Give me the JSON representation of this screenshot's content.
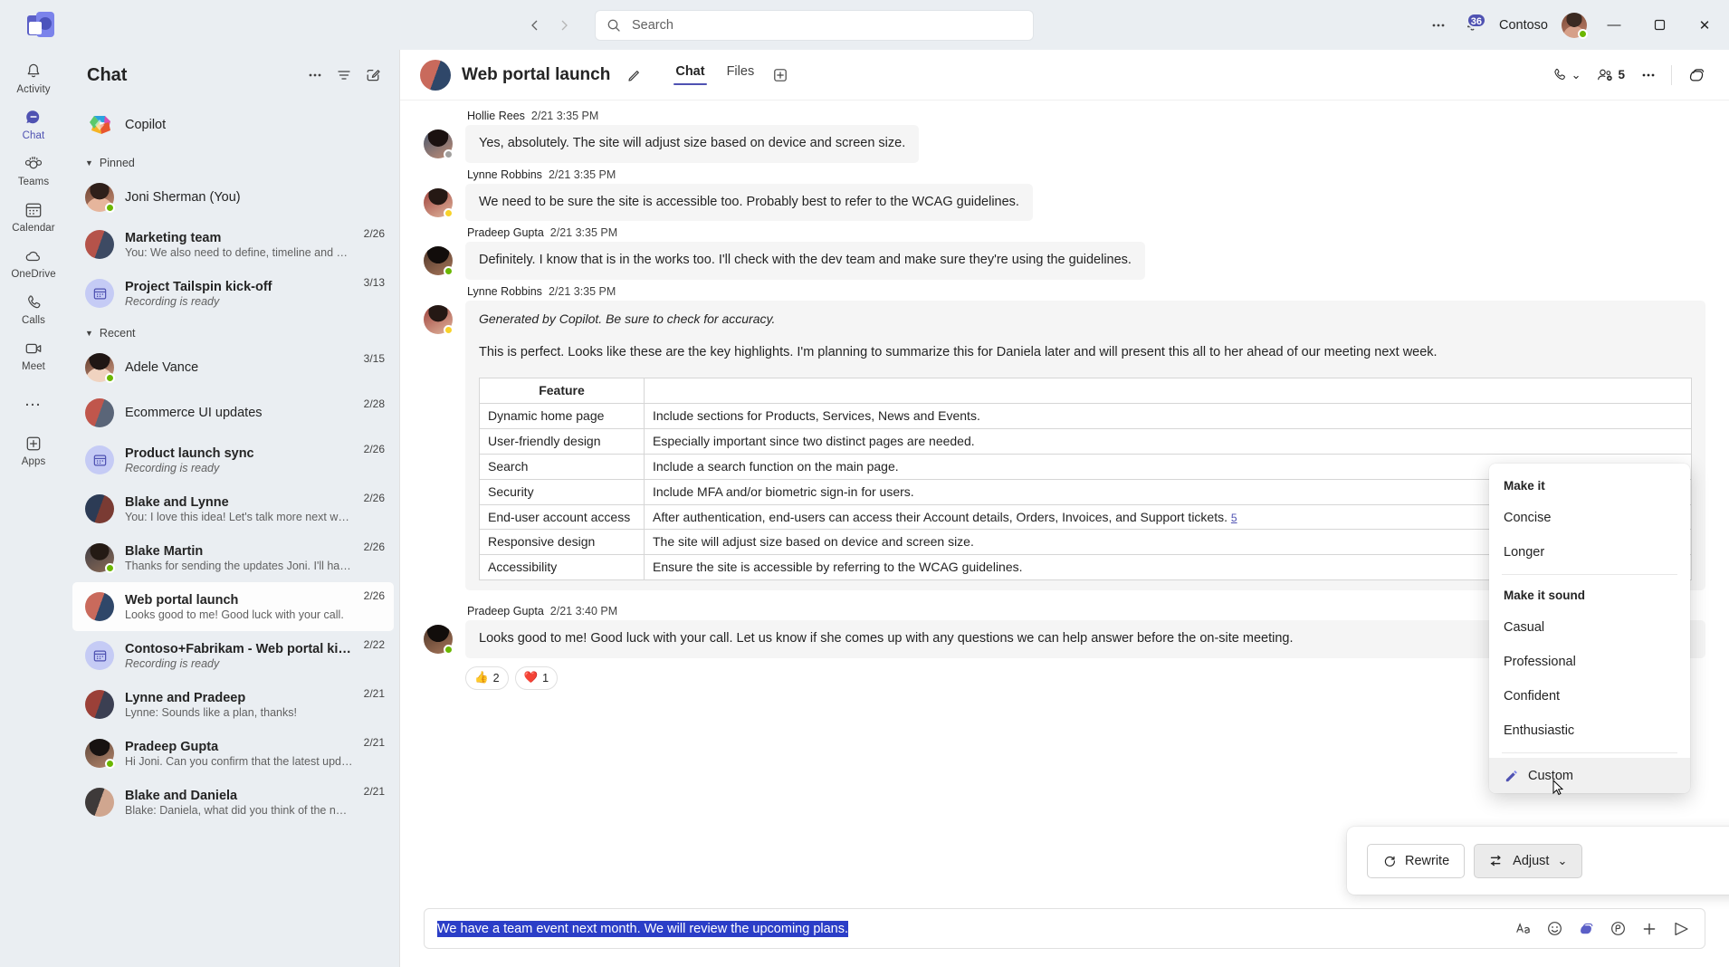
{
  "titlebar": {
    "app_logo": "teams-logo",
    "back_label": "‹",
    "forward_label": "›",
    "search": {
      "placeholder": "Search",
      "value": ""
    },
    "more_label": "…",
    "notification_badge": "36",
    "tenant": "Contoso",
    "minimize": "—",
    "maximize": "❐",
    "close": "✕"
  },
  "rail": {
    "items": [
      {
        "label": "Activity",
        "icon": "bell-icon"
      },
      {
        "label": "Chat",
        "icon": "chat-icon"
      },
      {
        "label": "Teams",
        "icon": "teams-people-icon"
      },
      {
        "label": "Calendar",
        "icon": "calendar-icon"
      },
      {
        "label": "OneDrive",
        "icon": "cloud-icon"
      },
      {
        "label": "Calls",
        "icon": "phone-icon"
      },
      {
        "label": "Meet",
        "icon": "video-icon"
      }
    ],
    "more_label": "…",
    "apps_label": "Apps"
  },
  "chatlist": {
    "title": "Chat",
    "more_label": "…",
    "filter_label": "filter-icon",
    "compose_label": "compose-icon",
    "copilot": {
      "name": "Copilot"
    },
    "sections": [
      {
        "label": "Pinned"
      },
      {
        "label": "Recent"
      }
    ],
    "pinned": [
      {
        "name": "Joni Sherman (You)",
        "preview": "",
        "date": "",
        "presence": "available",
        "avatar": "photo"
      },
      {
        "name": "Marketing team",
        "preview": "You: We also need to define, timeline and miles…",
        "date": "2/26",
        "presence": "",
        "avatar": "group"
      },
      {
        "name": "Project Tailspin kick-off",
        "preview": "Recording is ready",
        "date": "3/13",
        "presence": "",
        "avatar": "meeting"
      }
    ],
    "recent": [
      {
        "name": "Adele Vance",
        "preview": "",
        "date": "3/15",
        "presence": "available",
        "avatar": "photo"
      },
      {
        "name": "Ecommerce UI updates",
        "preview": "",
        "date": "2/28",
        "presence": "",
        "avatar": "group"
      },
      {
        "name": "Product launch sync",
        "preview": "Recording is ready",
        "date": "2/26",
        "presence": "",
        "avatar": "meeting"
      },
      {
        "name": "Blake and Lynne",
        "preview": "You: I love this idea! Let's talk more next week.",
        "date": "2/26",
        "presence": "",
        "avatar": "group"
      },
      {
        "name": "Blake Martin",
        "preview": "Thanks for sending the updates Joni. I'll have s…",
        "date": "2/26",
        "presence": "available",
        "avatar": "photo"
      },
      {
        "name": "Web portal launch",
        "preview": "Looks good to me! Good luck with your call.",
        "date": "2/26",
        "presence": "",
        "avatar": "group",
        "selected": true
      },
      {
        "name": "Contoso+Fabrikam - Web portal ki…",
        "preview": "Recording is ready",
        "date": "2/22",
        "presence": "",
        "avatar": "meeting"
      },
      {
        "name": "Lynne and Pradeep",
        "preview": "Lynne: Sounds like a plan, thanks!",
        "date": "2/21",
        "presence": "",
        "avatar": "group"
      },
      {
        "name": "Pradeep Gupta",
        "preview": "Hi Joni. Can you confirm that the latest updates…",
        "date": "2/21",
        "presence": "available",
        "avatar": "photo"
      },
      {
        "name": "Blake and Daniela",
        "preview": "Blake: Daniela, what did you think of the new d…",
        "date": "2/21",
        "presence": "",
        "avatar": "group"
      }
    ]
  },
  "chat_header": {
    "title": "Web portal launch",
    "edit_icon": "pencil-icon",
    "tabs": [
      {
        "label": "Chat",
        "active": true
      },
      {
        "label": "Files",
        "active": false
      }
    ],
    "add_tab_label": "+",
    "call_icon": "phone-icon",
    "call_chevron": "⌄",
    "people_count": "5",
    "more_label": "…",
    "copilot_icon": "copilot-icon"
  },
  "messages": [
    {
      "author": "Hollie Rees",
      "time": "2/21 3:35 PM",
      "text": "Yes, absolutely. The site will adjust size based on device and screen size.",
      "presence": "gray"
    },
    {
      "author": "Lynne Robbins",
      "time": "2/21 3:35 PM",
      "text": "We need to be sure the site is accessible too. Probably best to refer to the WCAG guidelines.",
      "presence": "away"
    },
    {
      "author": "Pradeep Gupta",
      "time": "2/21 3:35 PM",
      "text": "Definitely. I know that is in the works too. I'll check with the dev team and make sure they're using the guidelines.",
      "presence": "available"
    }
  ],
  "copilot_message": {
    "author": "Lynne Robbins",
    "time": "2/21 3:35 PM",
    "presence": "away",
    "disclaimer": "Generated by Copilot. Be sure to check for accuracy.",
    "text": "This is perfect. Looks like these are the key highlights. I'm planning to summarize this for Daniela later and will present this all to her ahead of our meeting next week.",
    "table": {
      "headers": [
        "Feature",
        ""
      ],
      "rows": [
        [
          "Dynamic home page",
          "Include sections for Products, Services, News and Events."
        ],
        [
          "User-friendly design",
          "Especially important since two distinct pages are needed."
        ],
        [
          "Search",
          "Include a search function on the main page."
        ],
        [
          "Security",
          "Include MFA and/or biometric sign-in for users."
        ],
        [
          "End-user account access",
          "After authentication, end-users can access their Account details, Orders, Invoices, and Support tickets."
        ],
        [
          "Responsive design",
          "The site will adjust size based on device and screen size."
        ],
        [
          "Accessibility",
          "Ensure the site is accessible by referring to the WCAG guidelines."
        ]
      ],
      "citation": "5"
    }
  },
  "last_message": {
    "author": "Pradeep Gupta",
    "time": "2/21 3:40 PM",
    "presence": "available",
    "text": "Looks good to me! Good luck with your call. Let us know if she comes up with any questions we can help answer before the on-site meeting.",
    "reactions": [
      {
        "emoji": "👍",
        "count": "2"
      },
      {
        "emoji": "❤️",
        "count": "1"
      }
    ]
  },
  "copilot_bar": {
    "rewrite_label": "Rewrite",
    "rewrite_icon": "refresh-icon",
    "adjust_label": "Adjust",
    "adjust_icon": "sliders-icon",
    "adjust_chevron": "⌄",
    "close_label": "✕"
  },
  "adjust_menu": {
    "group1_header": "Make it",
    "group1_items": [
      "Concise",
      "Longer"
    ],
    "group2_header": "Make it sound",
    "group2_items": [
      "Casual",
      "Professional",
      "Confident",
      "Enthusiastic"
    ],
    "custom_label": "Custom",
    "custom_icon": "edit-pen-icon"
  },
  "composer": {
    "text": "We have a team event next month. We will review the upcoming plans.",
    "icons": [
      {
        "name": "format-icon"
      },
      {
        "name": "emoji-icon"
      },
      {
        "name": "copilot-icon"
      },
      {
        "name": "loop-icon"
      },
      {
        "name": "plus-icon"
      },
      {
        "name": "send-icon"
      }
    ]
  },
  "colors": {
    "brand": "#4f52b2",
    "accent": "#5b5fc7",
    "selection": "#2b3ec7",
    "presence_available": "#6bb700",
    "presence_away": "#f8d22a",
    "rail_bg": "#eaeef2"
  }
}
